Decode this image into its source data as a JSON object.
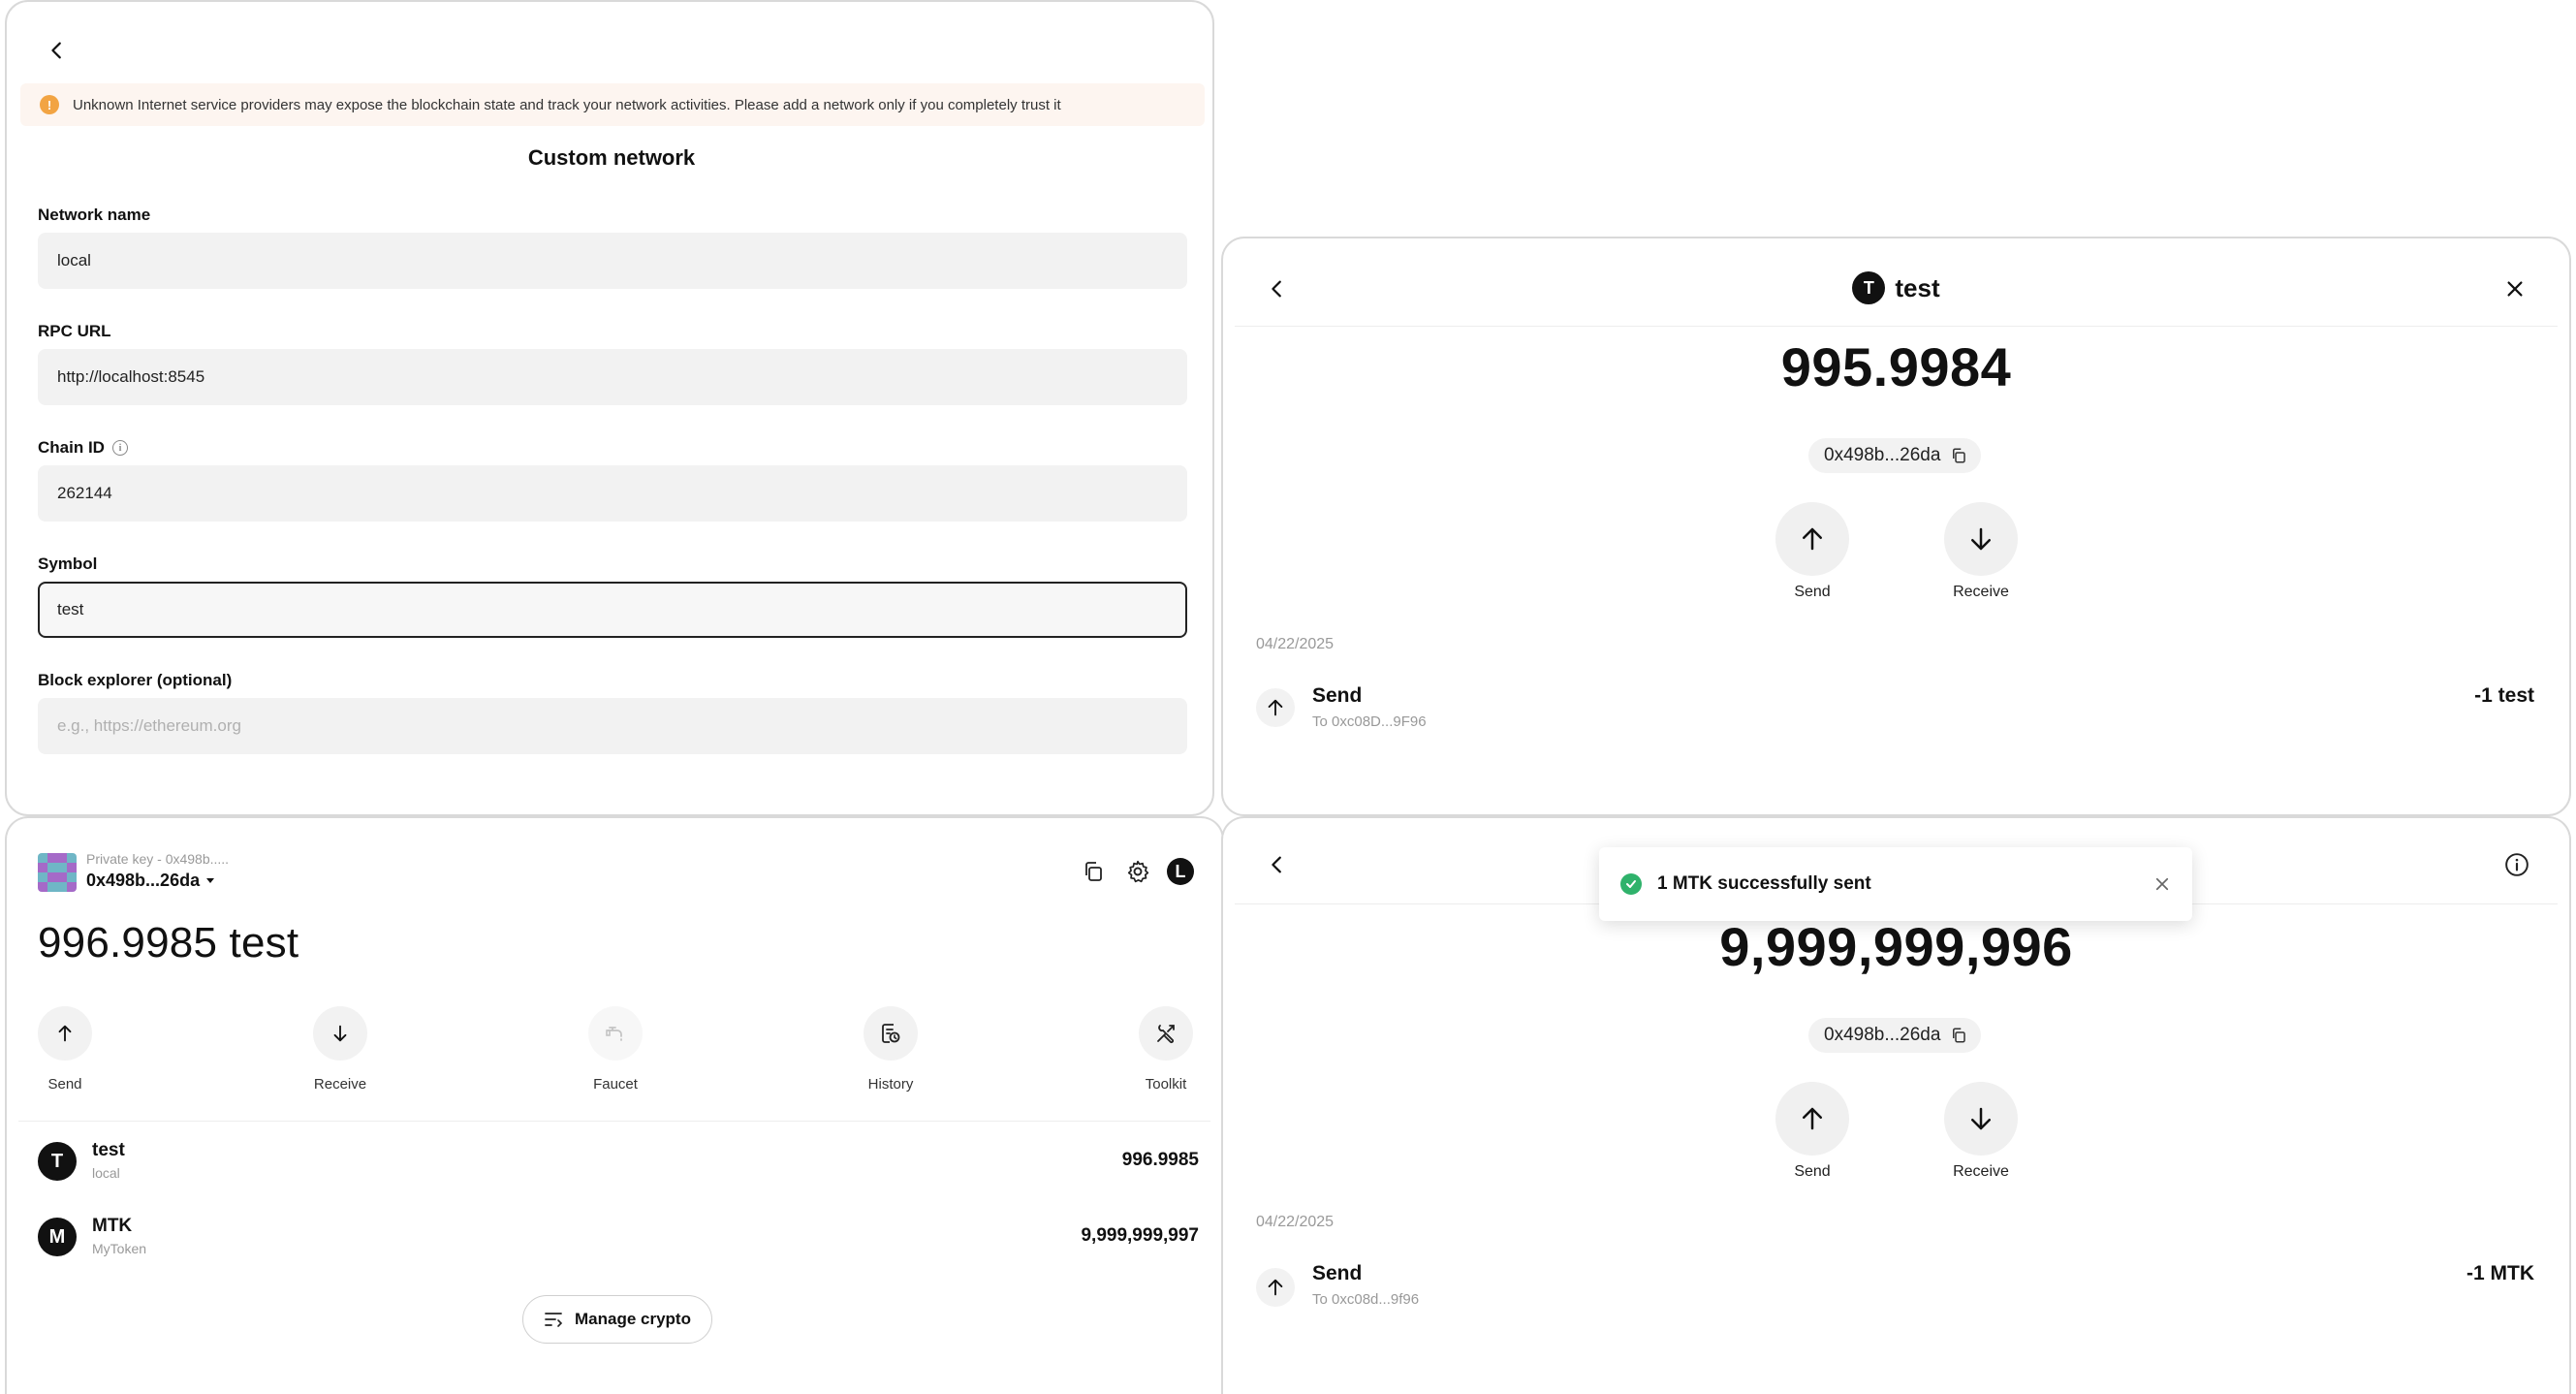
{
  "network_form": {
    "warning": "Unknown Internet service providers may expose the blockchain state and track your network activities. Please add a network only if you completely trust it",
    "warning_icon": "!",
    "title": "Custom network",
    "fields": {
      "network_name": {
        "label": "Network name",
        "value": "local"
      },
      "rpc_url": {
        "label": "RPC URL",
        "value": "http://localhost:8545"
      },
      "chain_id": {
        "label": "Chain ID",
        "value": "262144",
        "info_icon": "i"
      },
      "symbol": {
        "label": "Symbol",
        "value": "test"
      },
      "block_explorer": {
        "label": "Block explorer (optional)",
        "value": "",
        "placeholder": "e.g., https://ethereum.org"
      }
    }
  },
  "token_detail": {
    "avatar_letter": "T",
    "title": "test",
    "balance": "995.9984",
    "address": "0x498b...26da",
    "actions": {
      "send": "Send",
      "receive": "Receive"
    },
    "date": "04/22/2025",
    "tx": {
      "title": "Send",
      "to": "To 0xc08D...9F96",
      "amount": "-1 test"
    }
  },
  "wallet": {
    "account_label": "Private key - 0x498b.....",
    "address": "0x498b...26da",
    "header_avatar_letter": "L",
    "balance": "996.9985 test",
    "actions": {
      "send": "Send",
      "receive": "Receive",
      "faucet": "Faucet",
      "history": "History",
      "toolkit": "Toolkit"
    },
    "assets": [
      {
        "letter": "T",
        "name": "test",
        "sub": "local",
        "balance": "996.9985"
      },
      {
        "letter": "M",
        "name": "MTK",
        "sub": "MyToken",
        "balance": "9,999,999,997"
      }
    ],
    "manage_label": "Manage crypto"
  },
  "mtk_detail": {
    "toast": "1 MTK successfully sent",
    "balance": "9,999,999,996",
    "address": "0x498b...26da",
    "actions": {
      "send": "Send",
      "receive": "Receive"
    },
    "date": "04/22/2025",
    "tx": {
      "title": "Send",
      "to": "To 0xc08d...9f96",
      "amount": "-1 MTK"
    }
  },
  "colors": {
    "warning_accent": "#f2a443",
    "success": "#2fb26b",
    "avatar_dark": "#111111"
  }
}
